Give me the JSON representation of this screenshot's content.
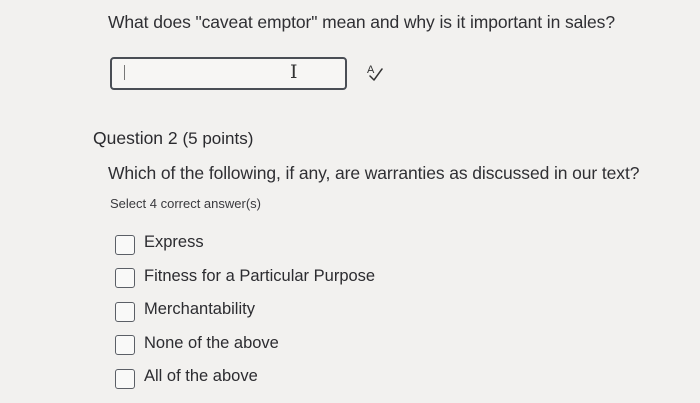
{
  "question1": {
    "prompt": "What does \"caveat emptor\" mean and why is it important in sales?",
    "answer_value": "",
    "spellcheck_icon": "spellcheck-icon"
  },
  "question2": {
    "heading": "Question 2",
    "points": "(5 points)",
    "prompt": "Which of the following, if any, are warranties as discussed in our text?",
    "instruction": "Select 4 correct answer(s)",
    "options": [
      {
        "label": "Express",
        "checked": false
      },
      {
        "label": "Fitness for a Particular Purpose",
        "checked": false
      },
      {
        "label": "Merchantability",
        "checked": false
      },
      {
        "label": "None of the above",
        "checked": false
      },
      {
        "label": "All of the above",
        "checked": false
      }
    ]
  }
}
